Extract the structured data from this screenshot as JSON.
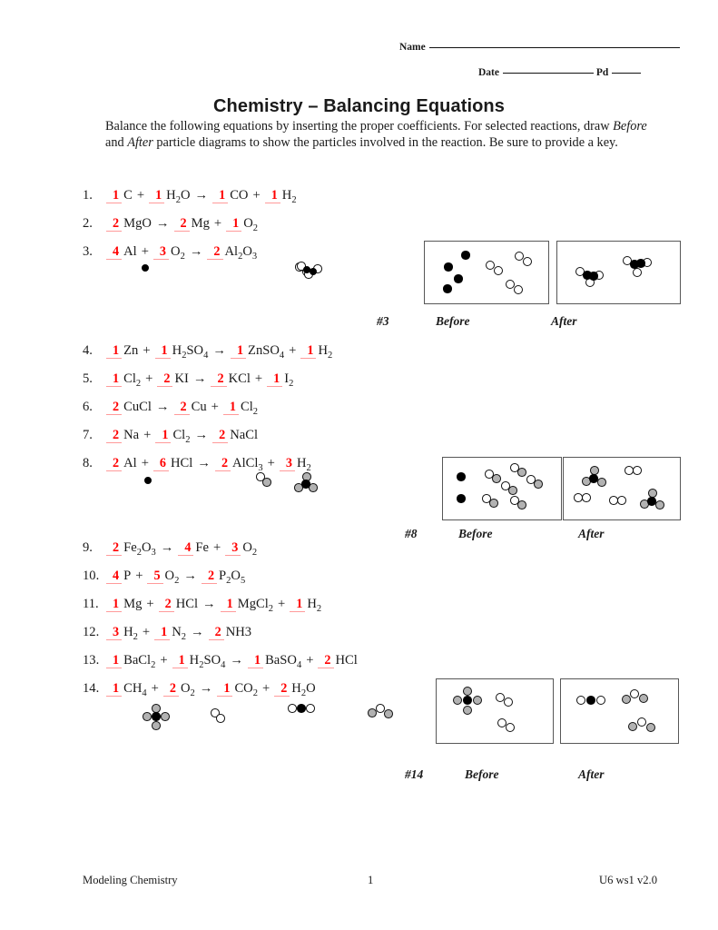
{
  "header": {
    "name_label": "Name",
    "date_label": "Date",
    "pd_label": "Pd"
  },
  "title": "Chemistry – Balancing Equations",
  "instructions_line1": "Balance the following equations by inserting the proper coefficients.  For selected",
  "instructions_line2a": "reactions, draw ",
  "instructions_before": "Before",
  "instructions_line2b": " and ",
  "instructions_after": "After",
  "instructions_line2c": " particle diagrams to show the particles involved in",
  "instructions_line3": "the reaction.  Be sure to provide a key.",
  "equations": [
    {
      "n": "1.",
      "coeffs": [
        "1",
        "1",
        "1",
        "1"
      ],
      "terms": [
        "C",
        "H2O",
        "CO",
        "H2"
      ],
      "ops": [
        "+",
        "→",
        "+"
      ]
    },
    {
      "n": "2.",
      "coeffs": [
        "2",
        "2",
        "1"
      ],
      "terms": [
        "MgO",
        "Mg",
        "O2"
      ],
      "ops": [
        "→",
        "+"
      ]
    },
    {
      "n": "3.",
      "coeffs": [
        "4",
        "3",
        "2"
      ],
      "terms": [
        "Al",
        "O2",
        "Al2O3"
      ],
      "ops": [
        "+",
        "→"
      ]
    },
    {
      "n": "4.",
      "coeffs": [
        "1",
        "1",
        "1",
        "1"
      ],
      "terms": [
        "Zn",
        "H2SO4",
        "ZnSO4",
        "H2"
      ],
      "ops": [
        "+",
        "→",
        "+"
      ]
    },
    {
      "n": "5.",
      "coeffs": [
        "1",
        "2",
        "2",
        "1"
      ],
      "terms": [
        "Cl2",
        "KI",
        "KCl",
        "I2"
      ],
      "ops": [
        "+",
        "→",
        "+"
      ]
    },
    {
      "n": "6.",
      "coeffs": [
        "2",
        "2",
        "1"
      ],
      "terms": [
        "CuCl",
        "Cu",
        "Cl2"
      ],
      "ops": [
        "→",
        "+"
      ]
    },
    {
      "n": "7.",
      "coeffs": [
        "2",
        "1",
        "2"
      ],
      "terms": [
        "Na",
        "Cl2",
        "NaCl"
      ],
      "ops": [
        "+",
        "→"
      ]
    },
    {
      "n": "8.",
      "coeffs": [
        "2",
        "6",
        "2",
        "3"
      ],
      "terms": [
        "Al",
        "HCl",
        "AlCl3",
        "H2"
      ],
      "ops": [
        "+",
        "→",
        "+"
      ]
    },
    {
      "n": "9.",
      "coeffs": [
        "2",
        "4",
        "3"
      ],
      "terms": [
        "Fe2O3",
        "Fe",
        "O2"
      ],
      "ops": [
        "→",
        "+"
      ]
    },
    {
      "n": "10.",
      "coeffs": [
        "4",
        "5",
        "2"
      ],
      "terms": [
        "P",
        "O2",
        "P2O5"
      ],
      "ops": [
        "+",
        "→"
      ]
    },
    {
      "n": "11.",
      "coeffs": [
        "1",
        "2",
        "1",
        "1"
      ],
      "terms": [
        "Mg",
        "HCl",
        "MgCl2",
        "H2"
      ],
      "ops": [
        "+",
        "→",
        "+"
      ]
    },
    {
      "n": "12.",
      "coeffs": [
        "3",
        "1",
        "2"
      ],
      "terms": [
        "H2",
        "N2",
        "NH3"
      ],
      "ops": [
        "+",
        "→"
      ]
    },
    {
      "n": "13.",
      "coeffs": [
        "1",
        "1",
        "1",
        "2"
      ],
      "terms": [
        "BaCl2",
        "H2SO4",
        "BaSO4",
        "HCl"
      ],
      "ops": [
        "+",
        "→",
        "+"
      ]
    },
    {
      "n": "14.",
      "coeffs": [
        "1",
        "2",
        "1",
        "2"
      ],
      "terms": [
        "CH4",
        "O2",
        "CO2",
        "H2O"
      ],
      "ops": [
        "+",
        "→",
        "+"
      ]
    }
  ],
  "diagrams": [
    {
      "tag": "#3",
      "before_label": "Before",
      "after_label": "After"
    },
    {
      "tag": "#8",
      "before_label": "Before",
      "after_label": "After"
    },
    {
      "tag": "#14",
      "before_label": "Before",
      "after_label": "After"
    }
  ],
  "colors": {
    "coefficient": "#ff0000",
    "coefficient_rule": "#ff9a9a",
    "box_border": "#575757",
    "atom_dark": "#000000",
    "atom_light": "#ffffff",
    "atom_gray": "#b2b2b2"
  },
  "footer": {
    "left": "Modeling Chemistry",
    "center": "1",
    "right": "U6 ws1 v2.0"
  }
}
